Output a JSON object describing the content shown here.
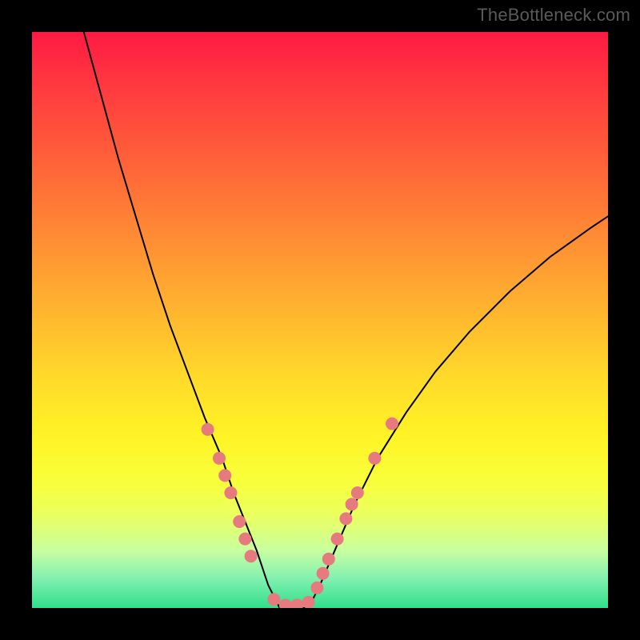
{
  "watermark": "TheBottleneck.com",
  "chart_data": {
    "type": "line",
    "title": "",
    "xlabel": "",
    "ylabel": "",
    "xlim": [
      0,
      100
    ],
    "ylim": [
      0,
      100
    ],
    "grid": false,
    "series": [
      {
        "name": "left-curve",
        "x": [
          9,
          12,
          15,
          18,
          21,
          24,
          27,
          30,
          33,
          35,
          37,
          39,
          40,
          41,
          42,
          43
        ],
        "y": [
          100,
          89,
          78,
          68,
          58,
          49,
          41,
          33,
          26,
          20,
          15,
          10,
          7,
          4,
          2,
          0
        ],
        "stroke": "#000000"
      },
      {
        "name": "right-curve",
        "x": [
          48,
          50,
          53,
          56,
          60,
          65,
          70,
          76,
          83,
          90,
          97,
          100
        ],
        "y": [
          0,
          4,
          11,
          18,
          26,
          34,
          41,
          48,
          55,
          61,
          66,
          68
        ],
        "stroke": "#000000"
      },
      {
        "name": "valley-floor",
        "x": [
          43,
          44,
          45,
          46,
          47,
          48
        ],
        "y": [
          0,
          0,
          0,
          0,
          0,
          0
        ],
        "stroke": "#000000"
      }
    ],
    "markers": [
      {
        "x": 30.5,
        "y": 31
      },
      {
        "x": 32.5,
        "y": 26
      },
      {
        "x": 33.5,
        "y": 23
      },
      {
        "x": 34.5,
        "y": 20
      },
      {
        "x": 36.0,
        "y": 15
      },
      {
        "x": 37.0,
        "y": 12
      },
      {
        "x": 38.0,
        "y": 9
      },
      {
        "x": 42.0,
        "y": 1.5
      },
      {
        "x": 44.0,
        "y": 0.5
      },
      {
        "x": 46.0,
        "y": 0.5
      },
      {
        "x": 48.0,
        "y": 1.0
      },
      {
        "x": 49.5,
        "y": 3.5
      },
      {
        "x": 50.5,
        "y": 6.0
      },
      {
        "x": 51.5,
        "y": 8.5
      },
      {
        "x": 53.0,
        "y": 12.0
      },
      {
        "x": 54.5,
        "y": 15.5
      },
      {
        "x": 55.5,
        "y": 18.0
      },
      {
        "x": 56.5,
        "y": 20.0
      },
      {
        "x": 59.5,
        "y": 26.0
      },
      {
        "x": 62.5,
        "y": 32.0
      }
    ],
    "marker_style": {
      "fill": "#e77a7f",
      "radius": 8
    },
    "gradient_stops": [
      {
        "offset": 0,
        "color": "#ff1a44"
      },
      {
        "offset": 50,
        "color": "#ffba2e"
      },
      {
        "offset": 78,
        "color": "#f8ff3a"
      },
      {
        "offset": 100,
        "color": "#2fe08a"
      }
    ]
  }
}
